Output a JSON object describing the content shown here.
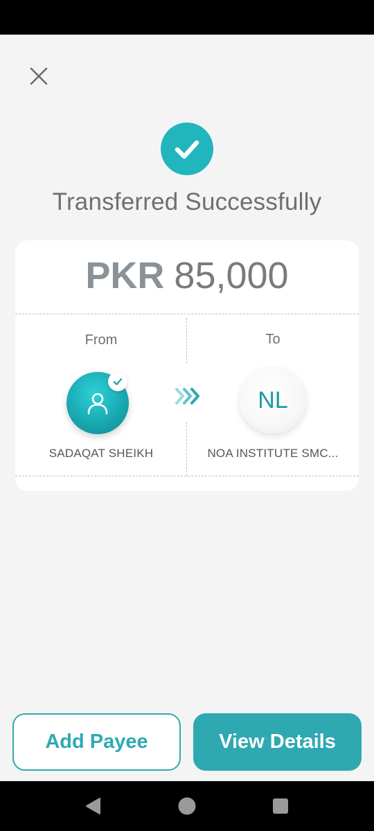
{
  "title": "Transferred Successfully",
  "amount": {
    "currency": "PKR",
    "value": "85,000"
  },
  "from": {
    "label": "From",
    "name": "SADAQAT SHEIKH"
  },
  "to": {
    "label": "To",
    "initials": "NL",
    "name": "NOA INSTITUTE SMC..."
  },
  "buttons": {
    "add_payee": "Add Payee",
    "view_details": "View Details"
  },
  "colors": {
    "accent": "#2fa9b1",
    "success": "#21b6be",
    "background": "#f4f4f4"
  },
  "icons": {
    "close": "close-icon",
    "success": "check-circle-icon",
    "from_avatar": "user-icon",
    "verified": "check-icon",
    "transfer": "triple-chevron-right-icon",
    "nav_back": "triangle-back-icon",
    "nav_home": "circle-home-icon",
    "nav_recents": "square-recents-icon"
  }
}
